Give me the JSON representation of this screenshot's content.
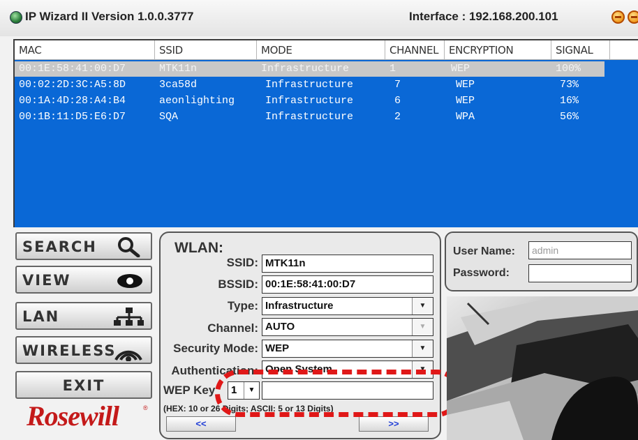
{
  "window": {
    "title": "IP Wizard II  Version 1.0.0.3777",
    "interface": "Interface : 192.168.200.101"
  },
  "table": {
    "columns": [
      "MAC",
      "SSID",
      "MODE",
      "CHANNEL",
      "ENCRYPTION",
      "SIGNAL"
    ],
    "rows": [
      {
        "mac": "00:1E:58:41:00:D7",
        "ssid": "MTK11n",
        "mode": "Infrastructure",
        "channel": "1",
        "encryption": "WEP",
        "signal": "100%",
        "selected": true
      },
      {
        "mac": "00:02:2D:3C:A5:8D",
        "ssid": "3ca58d",
        "mode": "Infrastructure",
        "channel": "7",
        "encryption": "WEP",
        "signal": "73%"
      },
      {
        "mac": "00:1A:4D:28:A4:B4",
        "ssid": "aeonlighting",
        "mode": "Infrastructure",
        "channel": "6",
        "encryption": "WEP",
        "signal": "16%"
      },
      {
        "mac": "00:1B:11:D5:E6:D7",
        "ssid": "SQA",
        "mode": "Infrastructure",
        "channel": "2",
        "encryption": "WPA",
        "signal": "56%"
      }
    ]
  },
  "nav": {
    "search": "SEARCH",
    "view": "VIEW",
    "lan": "LAN",
    "wireless": "WIRELESS",
    "exit": "EXIT"
  },
  "brand": {
    "logo": "Rosewill",
    "reg": "®"
  },
  "wlan": {
    "title": "WLAN:",
    "ssid_label": "SSID:",
    "ssid": "MTK11n",
    "bssid_label": "BSSID:",
    "bssid": "00:1E:58:41:00:D7",
    "type_label": "Type:",
    "type": "Infrastructure",
    "channel_label": "Channel:",
    "channel": "AUTO",
    "security_label": "Security Mode:",
    "security": "WEP",
    "auth_label": "Authentication:",
    "auth": "Open System",
    "wepkey_label": "WEP Key",
    "wepkey_index": "1",
    "wepkey_value": "",
    "hint": "(HEX: 10 or 26 Digits; ASCII: 5 or 13 Digits)",
    "prev": "<<",
    "next": ">>"
  },
  "login": {
    "username_label": "User Name:",
    "username_placeholder": "admin",
    "password_label": "Password:"
  },
  "colors": {
    "list_bg": "#0a68d6",
    "selected_row": "#c8c8c8",
    "highlight": "#e01818",
    "logo": "#c41a1a"
  }
}
